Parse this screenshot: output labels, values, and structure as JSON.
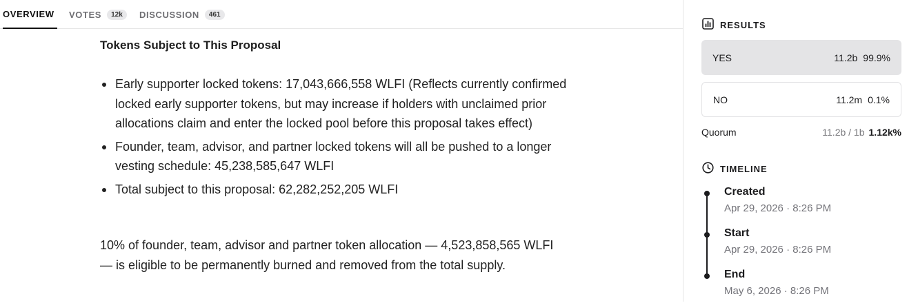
{
  "tabs": [
    {
      "label": "OVERVIEW",
      "badge": ""
    },
    {
      "label": "VOTES",
      "badge": "12k"
    },
    {
      "label": "DISCUSSION",
      "badge": "461"
    }
  ],
  "main": {
    "section_title": "Tokens Subject to This Proposal",
    "bullets": [
      "Early supporter locked tokens: 17,043,666,558 WLFI (Reflects currently confirmed locked early supporter tokens, but may increase if holders with unclaimed prior allocations claim and enter the locked pool before this proposal takes effect)",
      "Founder, team, advisor, and partner locked tokens will all be pushed to a longer vesting schedule: 45,238,585,647 WLFI",
      "Total subject to this proposal: 62,282,252,205 WLFI"
    ],
    "paragraph": "10% of founder, team, advisor and partner token allocation — 4,523,858,565 WLFI — is eligible to be permanently burned and removed from the total supply."
  },
  "results": {
    "header": "RESULTS",
    "icon": "bar-chart-icon",
    "options": [
      {
        "label": "YES",
        "amount": "11.2b",
        "percent": "99.9%"
      },
      {
        "label": "NO",
        "amount": "11.2m",
        "percent": "0.1%"
      }
    ],
    "quorum": {
      "label": "Quorum",
      "value": "11.2b / 1b",
      "percent": "1.12k%"
    }
  },
  "timeline": {
    "header": "TIMELINE",
    "icon": "clock-icon",
    "items": [
      {
        "title": "Created",
        "date": "Apr 29, 2026 · 8:26 PM"
      },
      {
        "title": "Start",
        "date": "Apr 29, 2026 · 8:26 PM"
      },
      {
        "title": "End",
        "date": "May 6, 2026 · 8:26 PM"
      }
    ]
  }
}
